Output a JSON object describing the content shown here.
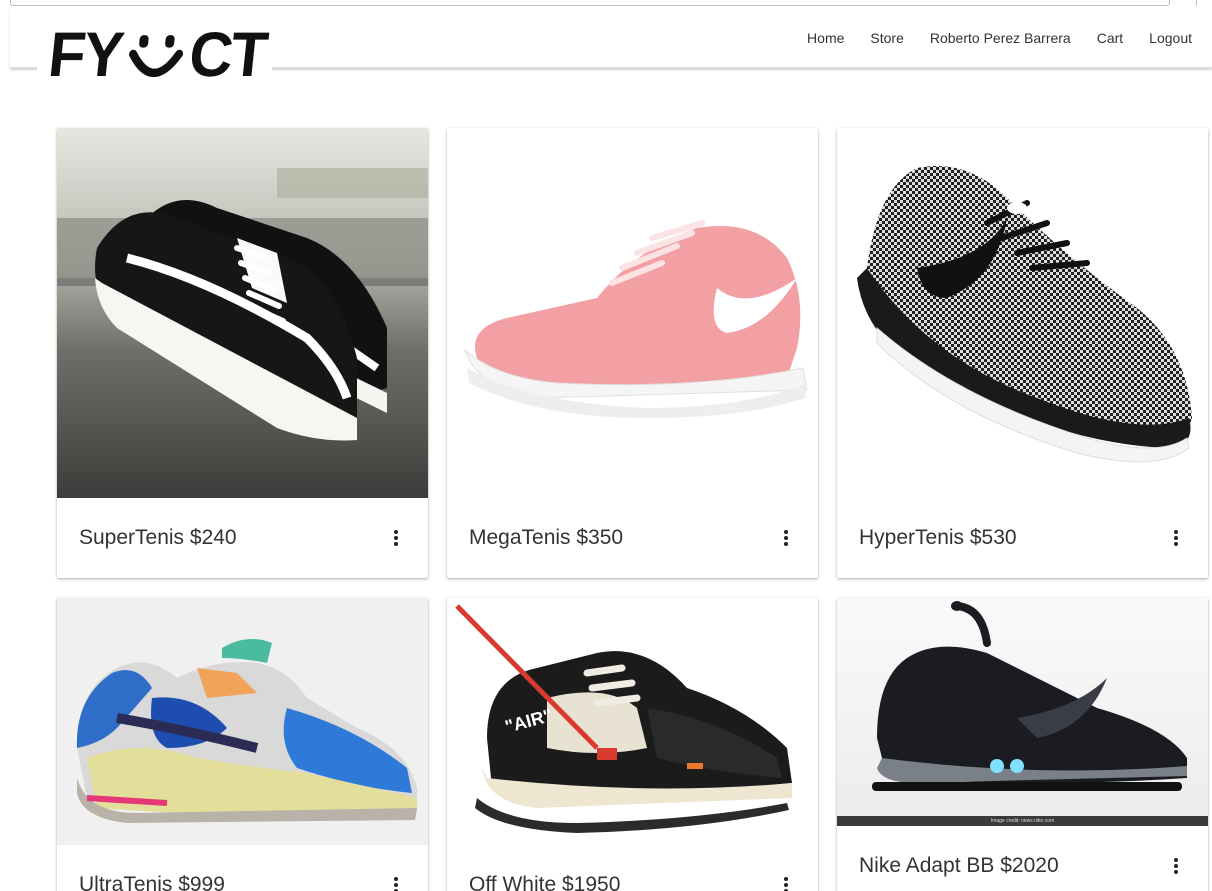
{
  "brand": {
    "logo_text_left": "FY",
    "logo_text_right": "CT"
  },
  "nav": {
    "links": [
      "Home",
      "Store",
      "Roberto Perez Barrera",
      "Cart",
      "Logout"
    ]
  },
  "products": [
    {
      "title": "SuperTenis $240",
      "image": "black-white-skate-sneaker-image"
    },
    {
      "title": "MegaTenis $350",
      "image": "pink-running-sneaker-image"
    },
    {
      "title": "HyperTenis $530",
      "image": "black-white-knit-sneaker-image"
    },
    {
      "title": "UltraTenis $999",
      "image": "multicolor-chunky-sneaker-image"
    },
    {
      "title": "Off White $1950",
      "image": "off-white-presto-sneaker-image"
    },
    {
      "title": "Nike Adapt BB $2020",
      "image": "nike-adapt-bb-sneaker-image",
      "credit": "Image credit: news.nike.com"
    }
  ],
  "colors": {
    "nav_text": "#333333",
    "card_bg": "#ffffff",
    "pink_shoe": "#f2a0a4"
  }
}
